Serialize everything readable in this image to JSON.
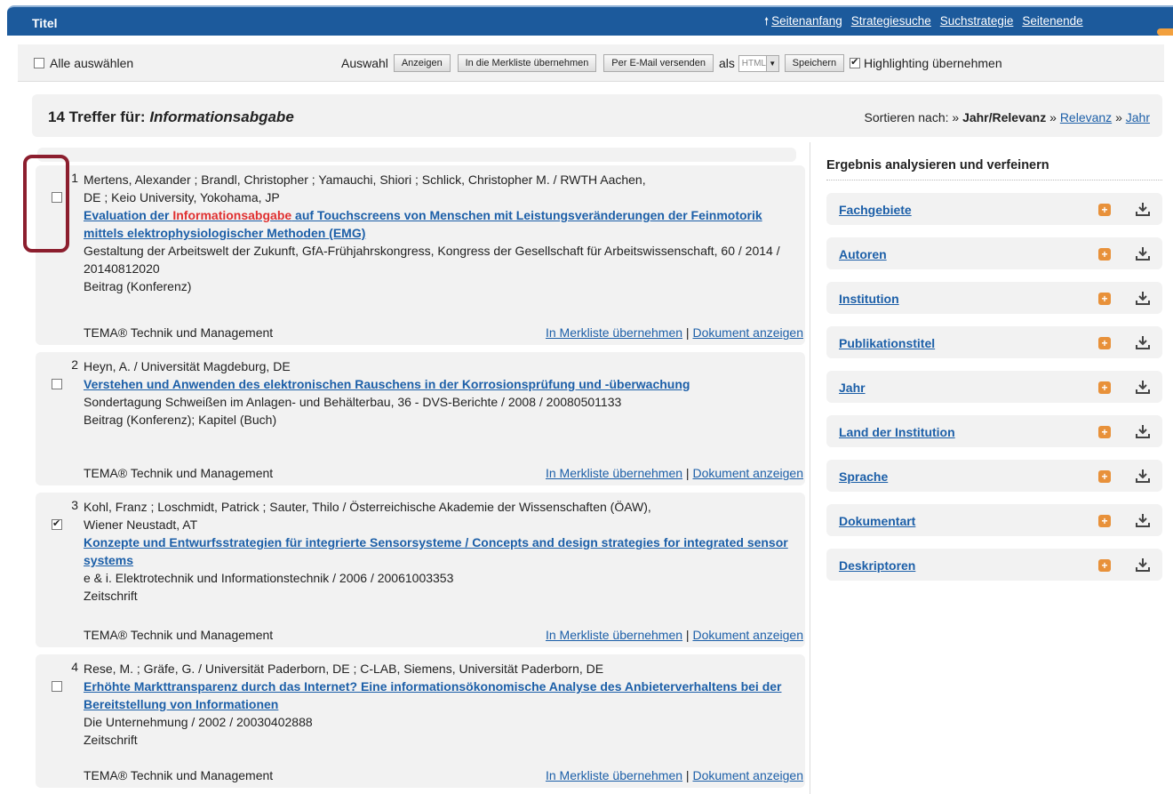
{
  "header": {
    "title": "Titel",
    "links": [
      "Seitenanfang",
      "Strategiesuche",
      "Suchstrategie",
      "Seitenende"
    ]
  },
  "toolbar": {
    "select_all": "Alle auswählen",
    "auswahl": "Auswahl",
    "btn_anzeigen": "Anzeigen",
    "btn_merkliste": "In die Merkliste übernehmen",
    "btn_email": "Per E-Mail versenden",
    "als": "als",
    "format": "HTML",
    "btn_speichern": "Speichern",
    "highlighting": "Highlighting übernehmen",
    "highlighting_checked": true
  },
  "results_header": {
    "count_prefix": "14 Treffer für: ",
    "query": "Informationsabgabe",
    "sort_label": "Sortieren nach: » ",
    "sort_active": "Jahr/Relevanz",
    "sep1": " » ",
    "sort_relevanz": "Relevanz",
    "sep2": " » ",
    "sort_jahr": "Jahr"
  },
  "results": [
    {
      "num": "1",
      "checked": false,
      "authors_line1": "Mertens, Alexander ; Brandl, Christopher ; Yamauchi, Shiori ; Schlick, Christopher M. / RWTH Aachen,",
      "authors_line2": "DE ; Keio University, Yokohama, JP",
      "title_pre": "Evaluation der ",
      "title_hl": "Informationsabgabe",
      "title_post": " auf Touchscreens von Menschen mit Leistungsveränderungen der Feinmotorik mittels elektrophysiologischer Methoden (EMG)",
      "meta1": "Gestaltung der Arbeitswelt der Zukunft, GfA-Frühjahrskongress, Kongress der Gesellschaft für Arbeitswissenschaft, 60 / 2014 / 20140812020",
      "meta2": "Beitrag (Konferenz)",
      "source": "TEMA® Technik und Management"
    },
    {
      "num": "2",
      "checked": false,
      "authors_line1": "Heyn, A. / Universität Magdeburg, DE",
      "authors_line2": "",
      "title_pre": "Verstehen und Anwenden des elektronischen Rauschens in der Korrosionsprüfung und -überwachung",
      "title_hl": "",
      "title_post": "",
      "meta1": "Sondertagung Schweißen im Anlagen- und Behälterbau, 36 - DVS-Berichte / 2008 / 20080501133",
      "meta2": "Beitrag (Konferenz); Kapitel (Buch)",
      "source": "TEMA® Technik und Management"
    },
    {
      "num": "3",
      "checked": true,
      "authors_line1": "Kohl, Franz ; Loschmidt, Patrick ; Sauter, Thilo / Österreichische Akademie der Wissenschaften (ÖAW),",
      "authors_line2": "Wiener Neustadt, AT",
      "title_pre": "Konzepte und Entwurfsstrategien für integrierte Sensorsysteme / Concepts and design strategies for integrated sensor systems",
      "title_hl": "",
      "title_post": "",
      "meta1": "e & i. Elektrotechnik und Informationstechnik / 2006 / 20061003353",
      "meta2": "Zeitschrift",
      "source": "TEMA® Technik und Management"
    },
    {
      "num": "4",
      "checked": false,
      "authors_line1": "Rese, M. ; Gräfe, G. / Universität Paderborn, DE ; C-LAB, Siemens, Universität Paderborn, DE",
      "authors_line2": "",
      "title_pre": "Erhöhte Markttransparenz durch das Internet? Eine informationsökonomische Analyse des Anbieterverhaltens bei der Bereitstellung von Informationen",
      "title_hl": "",
      "title_post": "",
      "meta1": "Die Unternehmung / 2002 / 20030402888",
      "meta2": "Zeitschrift",
      "source": "TEMA® Technik und Management"
    }
  ],
  "result_actions": {
    "merkliste": "In Merkliste übernehmen",
    "sep": " | ",
    "dokument": "Dokument anzeigen"
  },
  "sidebar": {
    "heading": "Ergebnis analysieren und verfeinern",
    "facets": [
      "Fachgebiete",
      "Autoren",
      "Institution",
      "Publikationstitel",
      "Jahr",
      "Land der Institution",
      "Sprache",
      "Dokumentart",
      "Deskriptoren"
    ]
  }
}
